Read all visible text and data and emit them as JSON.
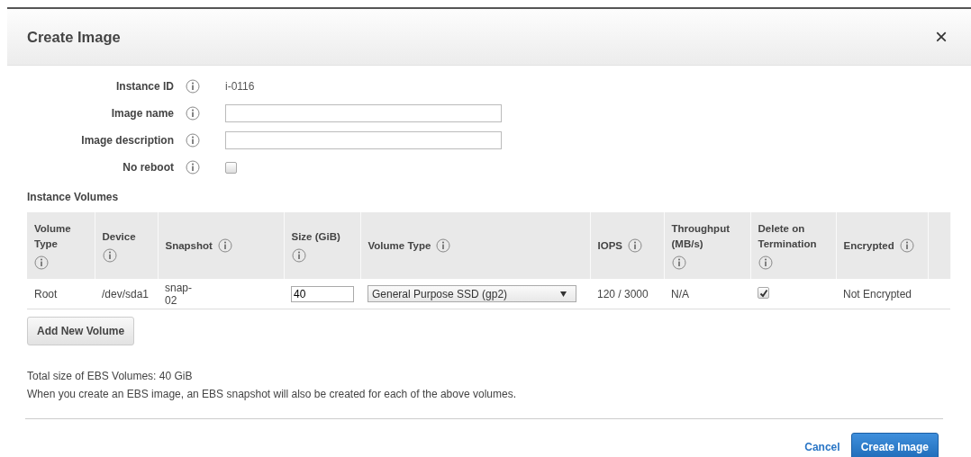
{
  "dialog": {
    "title": "Create Image",
    "close": "×"
  },
  "fields": [
    {
      "label": "Instance ID",
      "kind": "text",
      "value": "i-0116"
    },
    {
      "label": "Image name",
      "kind": "input"
    },
    {
      "label": "Image description",
      "kind": "input"
    },
    {
      "label": "No reboot",
      "kind": "checkbox",
      "checked": false
    }
  ],
  "volumes": {
    "title": "Instance Volumes",
    "columns": [
      {
        "label": "Volume Type"
      },
      {
        "label": "Device"
      },
      {
        "label": "Snapshot"
      },
      {
        "label": "Size (GiB)"
      },
      {
        "label": "Volume Type"
      },
      {
        "label": "IOPS"
      },
      {
        "label": "Throughput (MB/s)"
      },
      {
        "label": "Delete on Termination"
      },
      {
        "label": "Encrypted"
      }
    ],
    "rows": [
      [
        {
          "kind": "text",
          "text": "Root"
        },
        {
          "kind": "text",
          "text": "/dev/sda1"
        },
        {
          "kind": "text",
          "text": "snap-\n02"
        },
        {
          "kind": "input",
          "value": "40"
        },
        {
          "kind": "select",
          "value": "General Purpose SSD (gp2)"
        },
        {
          "kind": "text",
          "text": "120 / 3000"
        },
        {
          "kind": "text",
          "text": "N/A"
        },
        {
          "kind": "checkbox",
          "checked": true
        },
        {
          "kind": "text",
          "text": "Not Encrypted"
        }
      ]
    ],
    "add_button": "Add New Volume"
  },
  "notes": [
    "Total size of EBS Volumes: 40 GiB",
    "When you create an EBS image, an EBS snapshot will also be created for each of the above volumes."
  ],
  "buttons": [
    {
      "label": "Cancel",
      "kind": "link"
    },
    {
      "label": "Create Image",
      "kind": "primary"
    }
  ]
}
